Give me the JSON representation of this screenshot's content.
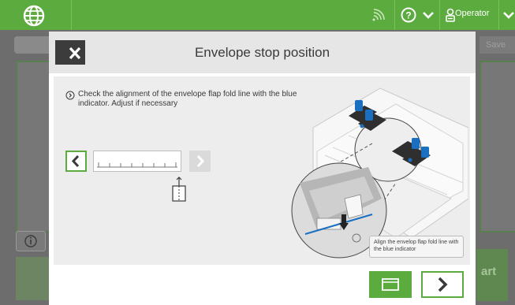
{
  "topbar": {
    "user_label": "Operator",
    "accent_color": "#5cab3e",
    "icons": [
      "globe-logo-icon",
      "wifi-signal-icon",
      "help-icon",
      "chevron-down-icon",
      "user-badge-icon",
      "chevron-down-icon"
    ]
  },
  "background": {
    "save_label": "Save",
    "start_label": "art"
  },
  "modal": {
    "title": "Envelope stop position",
    "instruction": "Check the alignment of the envelope flap fold line with the blue indicator. Adjust if necessary",
    "caption": "Align the envelop flap fold line with the blue indicator"
  }
}
